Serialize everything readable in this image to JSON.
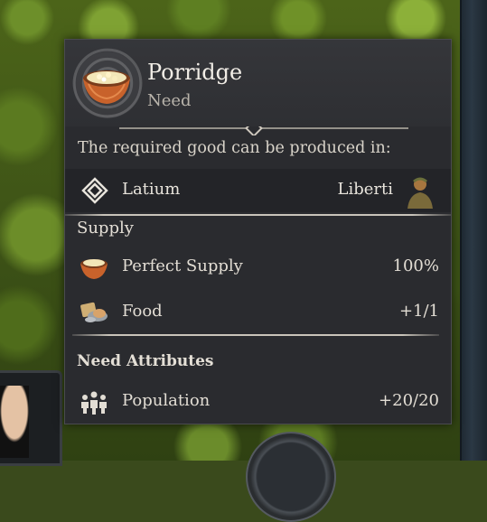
{
  "tooltip": {
    "title": "Porridge",
    "subtitle": "Need",
    "produced_in_label": "The required good can be produced in:",
    "production": {
      "region": "Latium",
      "producer": "Liberti"
    },
    "supply": {
      "section_label": "Supply",
      "rows": [
        {
          "label": "Perfect Supply",
          "value": "100%",
          "icon": "porridge-bowl-icon"
        },
        {
          "label": "Food",
          "value": "+1/1",
          "icon": "food-icon"
        }
      ]
    },
    "need_attributes": {
      "section_label": "Need Attributes",
      "rows": [
        {
          "label": "Population",
          "value": "+20/20",
          "icon": "population-icon"
        }
      ]
    }
  },
  "colors": {
    "panel_bg": "#2a2b2f",
    "text": "#e8e4dc",
    "muted_text": "#b9b4ab"
  }
}
